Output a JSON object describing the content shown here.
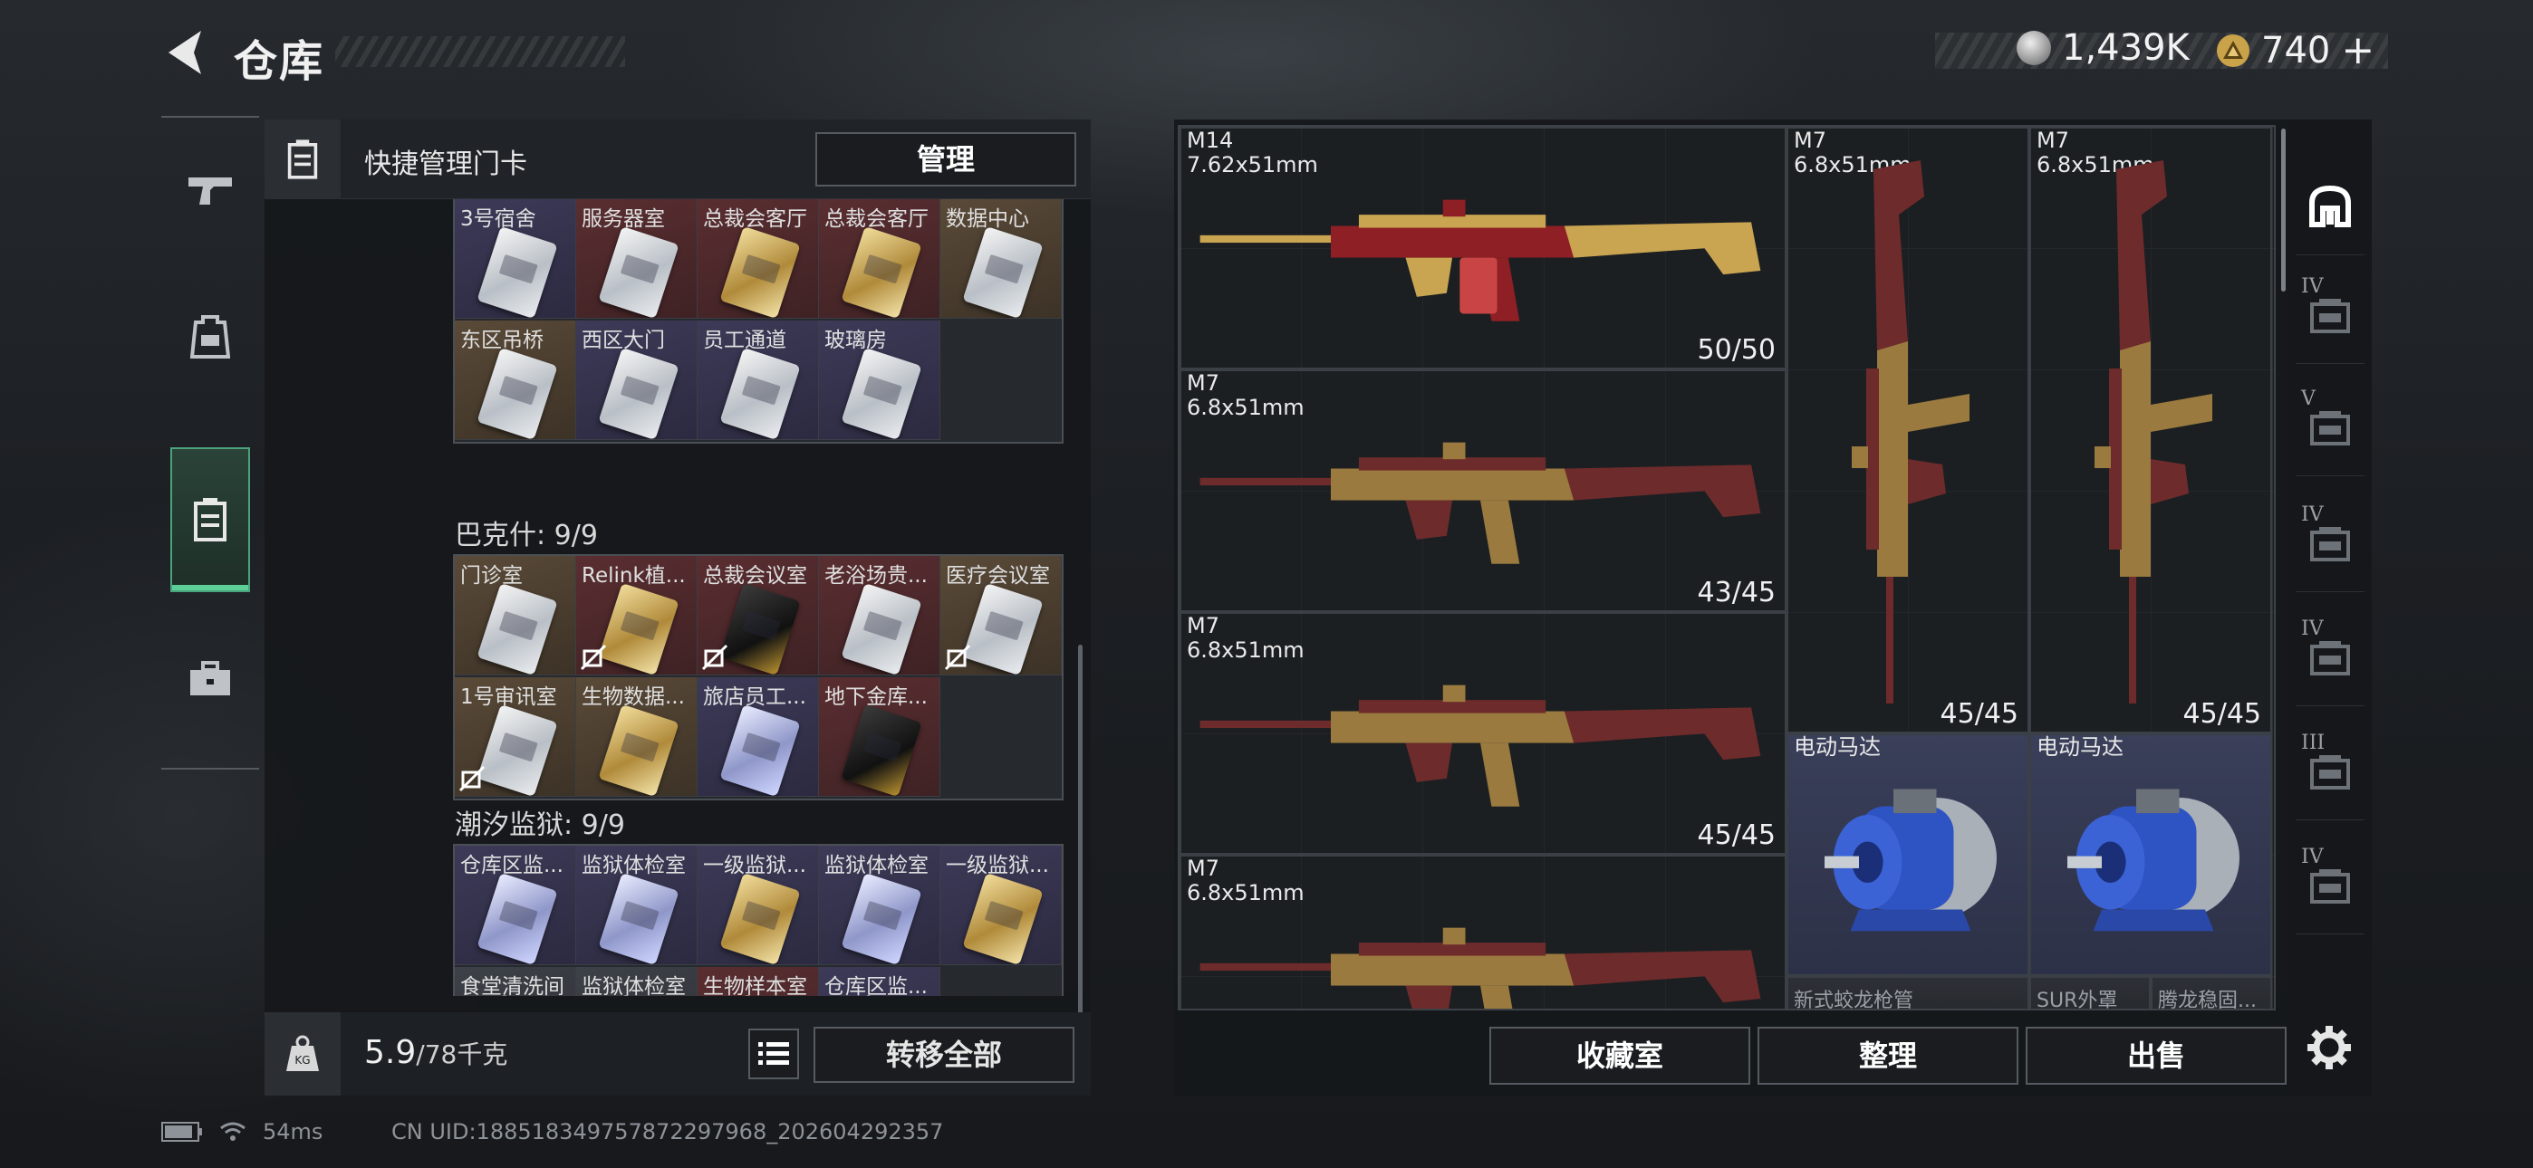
{
  "header": {
    "title": "仓库",
    "currency": [
      {
        "icon": "silver-coin-icon",
        "value": "1,439K"
      },
      {
        "icon": "gold-triangle-coin-icon",
        "value": "740"
      }
    ],
    "add_symbol": "+"
  },
  "rail": {
    "items": [
      {
        "name": "weapons",
        "icon": "pistol-icon",
        "active": false
      },
      {
        "name": "gear",
        "icon": "backpack-icon",
        "active": false
      },
      {
        "name": "keycards",
        "icon": "keycard-case-icon",
        "active": true
      },
      {
        "name": "misc",
        "icon": "toolbox-icon",
        "active": false
      }
    ]
  },
  "left_panel": {
    "quick_manage_label": "快捷管理门卡",
    "manage_button": "管理",
    "groups": [
      {
        "title": "",
        "cards": [
          {
            "label": "3号宿舍",
            "bg": "purple",
            "key": "silver",
            "no_link": false
          },
          {
            "label": "服务器室",
            "bg": "red",
            "key": "silver",
            "no_link": false
          },
          {
            "label": "总裁会客厅",
            "bg": "red",
            "key": "gold",
            "no_link": false
          },
          {
            "label": "总裁会客厅",
            "bg": "red",
            "key": "gold",
            "no_link": false
          },
          {
            "label": "数据中心",
            "bg": "brown",
            "key": "silver",
            "no_link": false
          },
          {
            "label": "东区吊桥",
            "bg": "brown",
            "key": "silver",
            "no_link": false
          },
          {
            "label": "西区大门",
            "bg": "purple",
            "key": "silver",
            "no_link": false
          },
          {
            "label": "员工通道",
            "bg": "purple",
            "key": "silver",
            "no_link": false
          },
          {
            "label": "玻璃房",
            "bg": "purple",
            "key": "silver",
            "no_link": false
          }
        ]
      },
      {
        "title": "巴克什: 9/9",
        "cards": [
          {
            "label": "门诊室",
            "bg": "brown",
            "key": "silver",
            "no_link": false
          },
          {
            "label": "Relink植...",
            "bg": "red",
            "key": "gold",
            "no_link": true
          },
          {
            "label": "总裁会议室",
            "bg": "red",
            "key": "black",
            "no_link": true
          },
          {
            "label": "老浴场贵...",
            "bg": "red",
            "key": "silver",
            "no_link": false
          },
          {
            "label": "医疗会议室",
            "bg": "brown",
            "key": "silver",
            "no_link": true
          },
          {
            "label": "1号审讯室",
            "bg": "brown",
            "key": "silver",
            "no_link": true
          },
          {
            "label": "生物数据...",
            "bg": "brown",
            "key": "gold",
            "no_link": false
          },
          {
            "label": "旅店员工...",
            "bg": "purple",
            "key": "blue",
            "no_link": false
          },
          {
            "label": "地下金库...",
            "bg": "red",
            "key": "black",
            "no_link": false
          }
        ]
      },
      {
        "title": "潮汐监狱: 9/9",
        "cards": [
          {
            "label": "仓库区监...",
            "bg": "purple",
            "key": "blue",
            "no_link": false
          },
          {
            "label": "监狱体检室",
            "bg": "purple",
            "key": "blue",
            "no_link": false
          },
          {
            "label": "一级监狱...",
            "bg": "purple",
            "key": "gold",
            "no_link": false
          },
          {
            "label": "监狱体检室",
            "bg": "purple",
            "key": "blue",
            "no_link": false
          },
          {
            "label": "一级监狱...",
            "bg": "purple",
            "key": "gold",
            "no_link": false
          },
          {
            "label": "食堂清洗间",
            "bg": "gray",
            "key": "silver",
            "no_link": false
          },
          {
            "label": "监狱体检室",
            "bg": "gray",
            "key": "silver",
            "no_link": false
          },
          {
            "label": "生物样本室",
            "bg": "red",
            "key": "gold",
            "no_link": false
          },
          {
            "label": "仓库区监...",
            "bg": "purple",
            "key": "silver",
            "no_link": false
          }
        ]
      }
    ],
    "weight_value": "5.9",
    "weight_max": "/78千克",
    "transfer_all": "转移全部"
  },
  "inventory": {
    "items": [
      {
        "name": "M14",
        "caliber": "7.62x51mm",
        "qty": "50/50",
        "kind": "rifle-h",
        "tone": "red"
      },
      {
        "name": "M7",
        "caliber": "6.8x51mm",
        "qty": "45/45",
        "kind": "rifle-v",
        "tone": "gold"
      },
      {
        "name": "M7",
        "caliber": "6.8x51mm",
        "qty": "45/45",
        "kind": "rifle-v",
        "tone": "gold"
      },
      {
        "name": "M7",
        "caliber": "6.8x51mm",
        "qty": "43/45",
        "kind": "rifle-h",
        "tone": "gold"
      },
      {
        "name": "M7",
        "caliber": "6.8x51mm",
        "qty": "45/45",
        "kind": "rifle-h",
        "tone": "gold"
      },
      {
        "name": "电动马达",
        "caliber": "",
        "qty": "",
        "kind": "motor",
        "tone": "blue"
      },
      {
        "name": "电动马达",
        "caliber": "",
        "qty": "",
        "kind": "motor",
        "tone": "blue"
      },
      {
        "name": "M7",
        "caliber": "6.8x51mm",
        "qty": "",
        "kind": "rifle-h",
        "tone": "gold"
      },
      {
        "name": "新式蛟龙枪管",
        "caliber": "",
        "qty": "",
        "kind": "part",
        "tone": "gray"
      },
      {
        "name": "SUR外罩",
        "caliber": "",
        "qty": "",
        "kind": "part",
        "tone": "gray"
      },
      {
        "name": "腾龙稳固...",
        "caliber": "",
        "qty": "",
        "kind": "part",
        "tone": "gray"
      }
    ],
    "side_tabs": [
      {
        "tier": "",
        "icon": "vault-icon",
        "active": true
      },
      {
        "tier": "IV",
        "icon": "safe-folder-icon",
        "active": false
      },
      {
        "tier": "V",
        "icon": "camera-case-icon",
        "active": false
      },
      {
        "tier": "IV",
        "icon": "file-case-icon",
        "active": false
      },
      {
        "tier": "IV",
        "icon": "safe-dial-icon",
        "active": false
      },
      {
        "tier": "III",
        "icon": "triangle-case-icon",
        "active": false
      },
      {
        "tier": "IV",
        "icon": "chest-icon",
        "active": false
      }
    ],
    "buttons": {
      "collection": "收藏室",
      "sort": "整理",
      "sell": "出售"
    }
  },
  "footer": {
    "ping": "54ms",
    "uid": "CN UID:1885183497578722979​68_202604292357"
  }
}
